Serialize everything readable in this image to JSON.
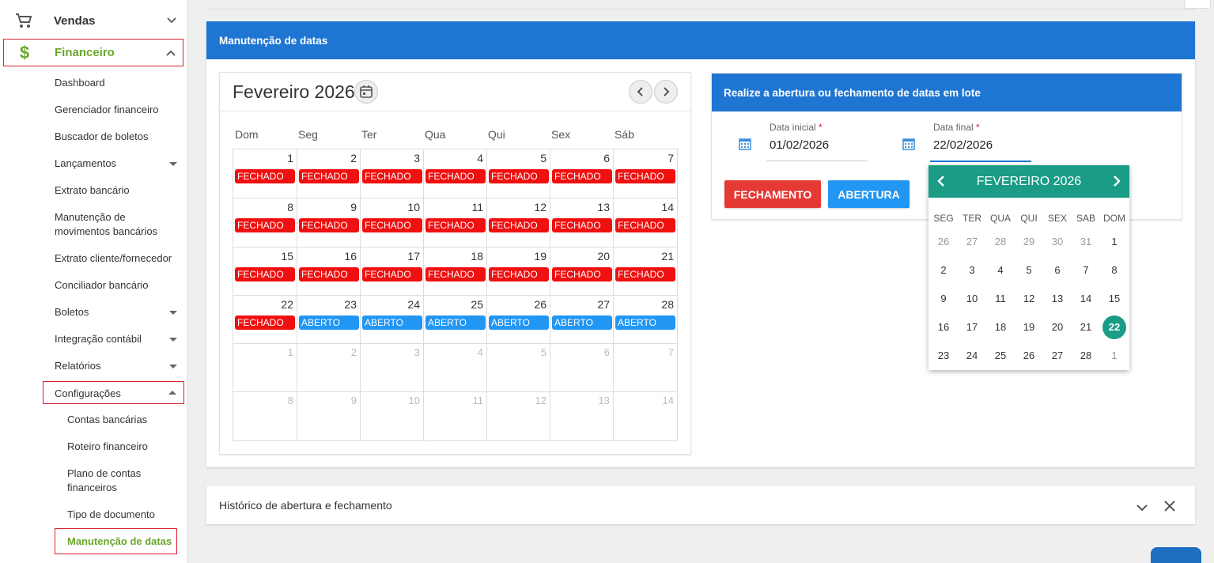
{
  "sidebar": {
    "vendas": "Vendas",
    "financeiro": "Financeiro",
    "items": [
      "Dashboard",
      "Gerenciador financeiro",
      "Buscador de boletos",
      "Lançamentos",
      "Extrato bancário",
      "Manutenção de",
      "movimentos bancários",
      "Extrato cliente/fornecedor",
      "Conciliador bancário",
      "Boletos",
      "Integração contábil",
      "Relatórios",
      "Configurações"
    ],
    "sub": [
      "Contas bancárias",
      "Roteiro financeiro",
      "Plano de contas",
      "financeiros",
      "Tipo de documento",
      "Manutenção de datas"
    ],
    "colors": {
      "active": "#6aa72b",
      "highlight_border": "#d9232d"
    }
  },
  "page": {
    "title": "Manutenção de datas",
    "accent": "#1e76d2"
  },
  "calendar": {
    "title": "Fevereiro 2026",
    "weekdays": [
      "Dom",
      "Seg",
      "Ter",
      "Qua",
      "Qui",
      "Sex",
      "Sáb"
    ],
    "closed_label": "FECHADO",
    "open_label": "ABERTO",
    "colors": {
      "closed": "#f01010",
      "open": "#2196f3"
    },
    "weeks": [
      [
        [
          "1",
          "c"
        ],
        [
          "2",
          "c"
        ],
        [
          "3",
          "c"
        ],
        [
          "4",
          "c"
        ],
        [
          "5",
          "c"
        ],
        [
          "6",
          "c"
        ],
        [
          "7",
          "c"
        ]
      ],
      [
        [
          "8",
          "c"
        ],
        [
          "9",
          "c"
        ],
        [
          "10",
          "c"
        ],
        [
          "11",
          "c"
        ],
        [
          "12",
          "c"
        ],
        [
          "13",
          "c"
        ],
        [
          "14",
          "c"
        ]
      ],
      [
        [
          "15",
          "c"
        ],
        [
          "16",
          "c"
        ],
        [
          "17",
          "c"
        ],
        [
          "18",
          "c"
        ],
        [
          "19",
          "c"
        ],
        [
          "20",
          "c"
        ],
        [
          "21",
          "c"
        ]
      ],
      [
        [
          "22",
          "c"
        ],
        [
          "23",
          "o"
        ],
        [
          "24",
          "o"
        ],
        [
          "25",
          "o"
        ],
        [
          "26",
          "o"
        ],
        [
          "27",
          "o"
        ],
        [
          "28",
          "o"
        ]
      ],
      [
        [
          "1",
          "x"
        ],
        [
          "2",
          "x"
        ],
        [
          "3",
          "x"
        ],
        [
          "4",
          "x"
        ],
        [
          "5",
          "x"
        ],
        [
          "6",
          "x"
        ],
        [
          "7",
          "x"
        ]
      ],
      [
        [
          "8",
          "x"
        ],
        [
          "9",
          "x"
        ],
        [
          "10",
          "x"
        ],
        [
          "11",
          "x"
        ],
        [
          "12",
          "x"
        ],
        [
          "13",
          "x"
        ],
        [
          "14",
          "x"
        ]
      ]
    ]
  },
  "batch": {
    "title": "Realize a abertura ou fechamento de datas em lote",
    "start_label": "Data inicial",
    "start_value": "01/02/2026",
    "end_label": "Data final",
    "end_value": "22/02/2026",
    "required_mark": "*",
    "close_button": "FECHAMENTO",
    "open_button": "ABERTURA",
    "colors": {
      "close_button": "#e53935",
      "open_button": "#2196f3"
    }
  },
  "picker": {
    "title": "FEVEREIRO 2026",
    "weekdays": [
      "SEG",
      "TER",
      "QUA",
      "QUI",
      "SEX",
      "SAB",
      "DOM"
    ],
    "weeks": [
      [
        [
          "26",
          "x"
        ],
        [
          "27",
          "x"
        ],
        [
          "28",
          "x"
        ],
        [
          "29",
          "x"
        ],
        [
          "30",
          "x"
        ],
        [
          "31",
          "x"
        ],
        [
          "1",
          ""
        ]
      ],
      [
        [
          "2",
          ""
        ],
        [
          "3",
          ""
        ],
        [
          "4",
          ""
        ],
        [
          "5",
          ""
        ],
        [
          "6",
          ""
        ],
        [
          "7",
          ""
        ],
        [
          "8",
          ""
        ]
      ],
      [
        [
          "9",
          ""
        ],
        [
          "10",
          ""
        ],
        [
          "11",
          ""
        ],
        [
          "12",
          ""
        ],
        [
          "13",
          ""
        ],
        [
          "14",
          ""
        ],
        [
          "15",
          ""
        ]
      ],
      [
        [
          "16",
          ""
        ],
        [
          "17",
          ""
        ],
        [
          "18",
          ""
        ],
        [
          "19",
          ""
        ],
        [
          "20",
          ""
        ],
        [
          "21",
          ""
        ],
        [
          "22",
          "s"
        ]
      ],
      [
        [
          "23",
          ""
        ],
        [
          "24",
          ""
        ],
        [
          "25",
          ""
        ],
        [
          "26",
          ""
        ],
        [
          "27",
          ""
        ],
        [
          "28",
          ""
        ],
        [
          "1",
          "x"
        ]
      ]
    ],
    "colors": {
      "header": "#1a9c86"
    }
  },
  "history": {
    "title": "Histórico de abertura e fechamento"
  },
  "icons": [
    "cart-icon",
    "dollar-icon",
    "chevron-down-icon",
    "chevron-up-icon",
    "calendar-icon",
    "chevron-left-icon",
    "chevron-right-icon",
    "close-icon"
  ]
}
